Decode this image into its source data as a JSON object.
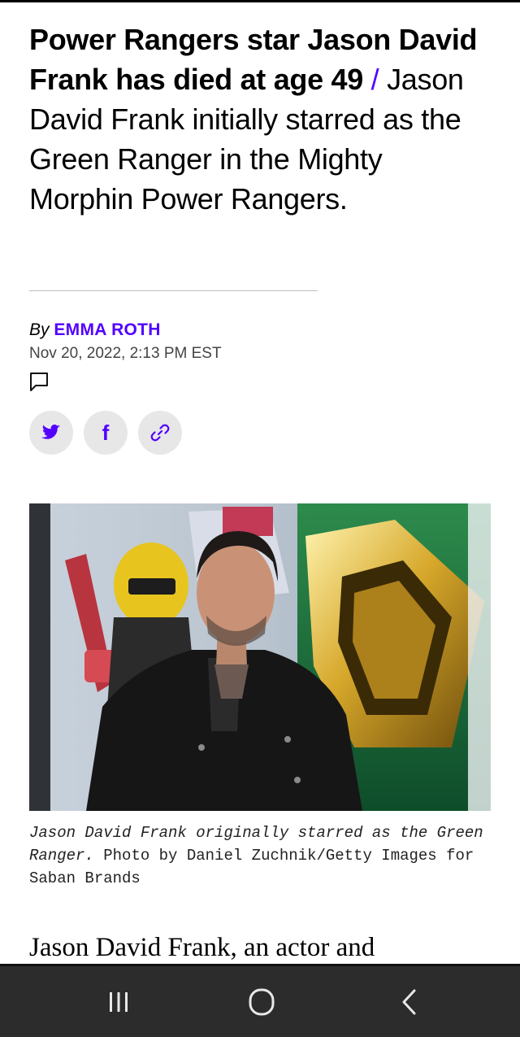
{
  "article": {
    "title": "Power Rangers star Jason David Frank has died at age 49",
    "separator": "/",
    "dek": "Jason David Frank initially starred as the Green Ranger in the Mighty Morphin Power Rangers.",
    "byline_prefix": "By",
    "author": "EMMA ROTH",
    "timestamp": "Nov 20, 2022, 2:13 PM EST",
    "caption_text": "Jason David Frank originally starred as the Green Ranger.",
    "caption_credit": "Photo by Daniel Zuchnik/Getty Images for Saban Brands",
    "body_start": "Jason David Frank, an actor and"
  },
  "share": {
    "icons": [
      "twitter-icon",
      "facebook-icon",
      "link-icon"
    ],
    "facebook_glyph": "f"
  },
  "colors": {
    "accent": "#5200ff",
    "navbar": "#2c2c2c",
    "share_bg": "#e7e7e7"
  },
  "navbar": {
    "icons": [
      "recent-apps-icon",
      "home-icon",
      "back-icon"
    ]
  }
}
